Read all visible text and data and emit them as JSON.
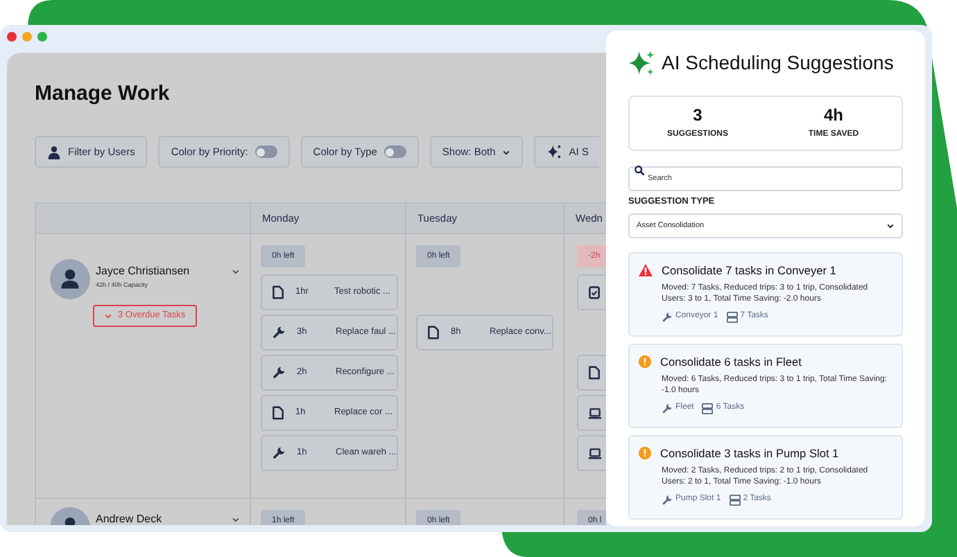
{
  "page_title": "Manage Work",
  "toolbar": [
    {
      "kind": "filter",
      "label": "Filter by Users"
    },
    {
      "kind": "toggle",
      "label": "Color by Priority:",
      "on": false
    },
    {
      "kind": "toggle",
      "label": "Color by Type",
      "on": false
    },
    {
      "kind": "dropdown",
      "label": "Show: Both"
    },
    {
      "kind": "ai",
      "label": "AI S"
    }
  ],
  "schedule": {
    "columns": [
      "Monday",
      "Tuesday",
      "Wedn"
    ],
    "rows": [
      {
        "name": "Jayce Christiansen",
        "capacity": "42h / 40h Capacity",
        "overdue": "3 Overdue Tasks",
        "days": [
          {
            "remaining": "0h left",
            "over": false,
            "tasks": [
              {
                "kind": "document",
                "hours": "1hr",
                "title": "Test robotic ..."
              },
              {
                "kind": "wrench",
                "hours": "3h",
                "title": "Replace faul ..."
              },
              {
                "kind": "wrench",
                "hours": "2h",
                "title": "Reconfigure ..."
              },
              {
                "kind": "document",
                "hours": "1h",
                "title": "Replace cor ..."
              },
              {
                "kind": "wrench",
                "hours": "1h",
                "title": "Clean wareh ..."
              }
            ]
          },
          {
            "remaining": "0h left",
            "over": false,
            "tasks": [
              {
                "kind": "gap"
              },
              {
                "kind": "document",
                "hours": "8h",
                "title": "Replace conv..."
              }
            ]
          },
          {
            "remaining": "-2h",
            "over": true,
            "tasks": [
              {
                "kind": "clipboard"
              },
              {
                "kind": "gap"
              },
              {
                "kind": "document"
              },
              {
                "kind": "laptop"
              },
              {
                "kind": "laptop"
              }
            ]
          }
        ]
      },
      {
        "name": "Andrew Deck",
        "days": [
          {
            "remaining": "1h left",
            "over": false
          },
          {
            "remaining": "0h left",
            "over": false
          },
          {
            "remaining": "0h l",
            "over": false
          }
        ]
      }
    ]
  },
  "ai_panel": {
    "title": "AI Scheduling Suggestions",
    "stats": [
      {
        "value": "3",
        "label": "SUGGESTIONS"
      },
      {
        "value": "4h",
        "label": "TIME SAVED"
      }
    ],
    "search": {
      "placeholder": "Search"
    },
    "type_label": "SUGGESTION TYPE",
    "type_select": {
      "value": "Asset Consolidation"
    },
    "suggestions": [
      {
        "kind": "critical",
        "title": "Consolidate 7 tasks in Conveyer 1",
        "details": "Moved: 7 Tasks, Reduced trips: 3 to 1 trip, Consolidated Users: 3 to 1, Total Time Saving: -2.0 hours",
        "asset": "Conveyor 1",
        "task_count": "7 Tasks"
      },
      {
        "kind": "warning",
        "title": "Consolidate 6 tasks in Fleet",
        "details": "Moved: 6 Tasks, Reduced trips: 3 to 1 trip, Total Time Saving: -1.0 hours",
        "asset": "Fleet",
        "task_count": "6 Tasks"
      },
      {
        "kind": "warning",
        "title": "Consolidate 3 tasks in Pump Slot 1",
        "details": "Moved: 2 Tasks, Reduced trips: 2 to 1 trip, Consolidated Users: 2 to 1, Total Time Saving: -1.0 hours",
        "asset": "Pump Slot 1",
        "task_count": "2 Tasks"
      }
    ]
  }
}
